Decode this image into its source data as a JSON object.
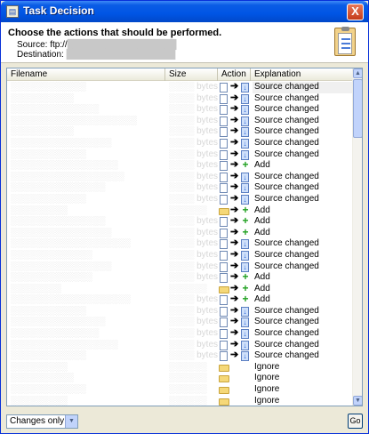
{
  "window": {
    "title": "Task Decision",
    "close_label": "X"
  },
  "header": {
    "heading": "Choose the actions that should be performed.",
    "source_label": "Source: ftp://",
    "source_value": "████████████████████",
    "destination_label": "Destination:",
    "destination_value": "████████████████████"
  },
  "list": {
    "columns": {
      "filename": "Filename",
      "size": "Size",
      "action": "Action",
      "explanation": "Explanation"
    },
    "rows": [
      {
        "filename": "░░░░░░░░░░░░",
        "size": "░░░░ bytes",
        "icon": "file",
        "op": "update",
        "explanation": "Source changed",
        "selected": true
      },
      {
        "filename": "░░░░░░░░░░",
        "size": "░░░░ bytes",
        "icon": "file",
        "op": "update",
        "explanation": "Source changed"
      },
      {
        "filename": "░░░░░░░░░░░░░░",
        "size": "░░░░ bytes",
        "icon": "file",
        "op": "update",
        "explanation": "Source changed"
      },
      {
        "filename": "░░░░░░░░░░░░░░░░░░░░",
        "size": "░░░░ bytes",
        "icon": "file",
        "op": "update",
        "explanation": "Source changed"
      },
      {
        "filename": "░░░░░░░░░░",
        "size": "░░░░ bytes",
        "icon": "file",
        "op": "update",
        "explanation": "Source changed"
      },
      {
        "filename": "░░░░░░░░░░░░░░░░",
        "size": "░░░░ bytes",
        "icon": "file",
        "op": "update",
        "explanation": "Source changed"
      },
      {
        "filename": "░░░░░░░░░░░░",
        "size": "░░░░ bytes",
        "icon": "file",
        "op": "update",
        "explanation": "Source changed"
      },
      {
        "filename": "░░░░░░░░░░░░░░░░░",
        "size": "░░░░ bytes",
        "icon": "file",
        "op": "add",
        "explanation": "Add"
      },
      {
        "filename": "░░░░░░░░░░░░░░░░░░",
        "size": "░░░░ bytes",
        "icon": "file",
        "op": "update",
        "explanation": "Source changed"
      },
      {
        "filename": "░░░░░░░░░░░░░░░",
        "size": "░░░░ bytes",
        "icon": "file",
        "op": "update",
        "explanation": "Source changed"
      },
      {
        "filename": "░░░░░░░░░░░░",
        "size": "░░░░ bytes",
        "icon": "file",
        "op": "update",
        "explanation": "Source changed"
      },
      {
        "filename": "░░░░░░░░░",
        "size": "░░░░░░",
        "icon": "folder",
        "op": "add",
        "explanation": "Add"
      },
      {
        "filename": "░░░░░░░░░░░░░░░",
        "size": "░░░░ bytes",
        "icon": "file",
        "op": "add",
        "explanation": "Add"
      },
      {
        "filename": "░░░░░░░░░░░░░░░░",
        "size": "░░░░ bytes",
        "icon": "file",
        "op": "add",
        "explanation": "Add"
      },
      {
        "filename": "░░░░░░░░░░░░░░░░░░░",
        "size": "░░░░ bytes",
        "icon": "file",
        "op": "update",
        "explanation": "Source changed"
      },
      {
        "filename": "░░░░░░░░░░░░░",
        "size": "░░░░ bytes",
        "icon": "file",
        "op": "update",
        "explanation": "Source changed"
      },
      {
        "filename": "░░░░░░░░░░░░░░░░",
        "size": "░░░░ bytes",
        "icon": "file",
        "op": "update",
        "explanation": "Source changed"
      },
      {
        "filename": "░░░░░░░░░░░░░",
        "size": "░░░░ bytes",
        "icon": "file",
        "op": "add",
        "explanation": "Add"
      },
      {
        "filename": "░░░░░░░░",
        "size": "░░░░░░",
        "icon": "folder",
        "op": "add",
        "explanation": "Add"
      },
      {
        "filename": "░░░░░░░░░░░░░░░░░░░",
        "size": "░░░░ bytes",
        "icon": "file",
        "op": "add",
        "explanation": "Add"
      },
      {
        "filename": "░░░░░░░░░░░░",
        "size": "░░░░ bytes",
        "icon": "file",
        "op": "update",
        "explanation": "Source changed"
      },
      {
        "filename": "░░░░░░░░░░░░░░░",
        "size": "░░░░ bytes",
        "icon": "file",
        "op": "update",
        "explanation": "Source changed"
      },
      {
        "filename": "░░░░░░░░░░░░░░",
        "size": "░░░░ bytes",
        "icon": "file",
        "op": "update",
        "explanation": "Source changed"
      },
      {
        "filename": "░░░░░░░░░░░░░░░░░",
        "size": "░░░░ bytes",
        "icon": "file",
        "op": "update",
        "explanation": "Source changed"
      },
      {
        "filename": "░░░░░░░░░░░░",
        "size": "░░░░ bytes",
        "icon": "file",
        "op": "update",
        "explanation": "Source changed"
      },
      {
        "filename": "░░░░░░░░░",
        "size": "░░░░░░",
        "icon": "folder",
        "op": "none",
        "explanation": "Ignore"
      },
      {
        "filename": "░░░░░░░░░░",
        "size": "░░░░░░",
        "icon": "folder",
        "op": "none",
        "explanation": "Ignore"
      },
      {
        "filename": "░░░░░░░░░░░░",
        "size": "░░░░░░",
        "icon": "folder",
        "op": "none",
        "explanation": "Ignore"
      },
      {
        "filename": "░░░░░░░░░",
        "size": "░░░░░░",
        "icon": "folder",
        "op": "none",
        "explanation": "Ignore"
      }
    ]
  },
  "footer": {
    "filter_value": "Changes only",
    "go_label": "Go"
  }
}
